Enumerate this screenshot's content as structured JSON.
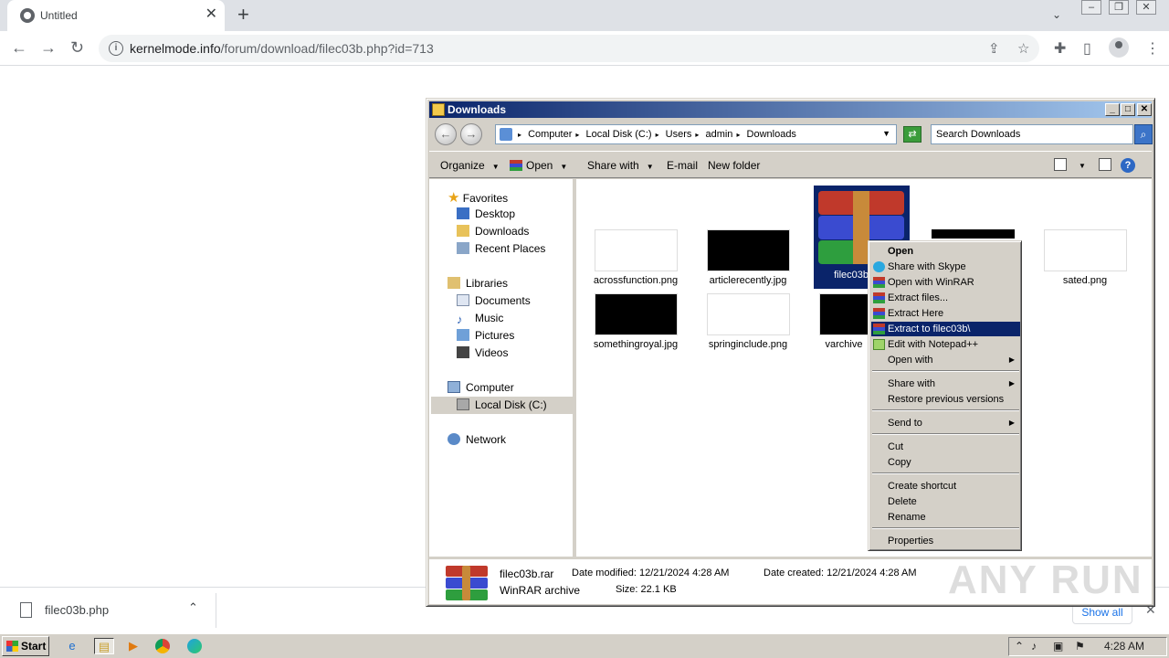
{
  "browser": {
    "tab_title": "Untitled",
    "url_host": "kernelmode.info",
    "url_path": "/forum/download/filec03b.php?id=713"
  },
  "download_bar": {
    "filename": "filec03b.php",
    "show_all": "Show all"
  },
  "explorer": {
    "title": "Downloads",
    "breadcrumbs": [
      "Computer",
      "Local Disk (C:)",
      "Users",
      "admin",
      "Downloads"
    ],
    "search_placeholder": "Search Downloads",
    "commands": {
      "organize": "Organize",
      "open": "Open",
      "share_with": "Share with",
      "email": "E-mail",
      "new_folder": "New folder"
    },
    "nav": {
      "favorites": "Favorites",
      "desktop": "Desktop",
      "downloads": "Downloads",
      "recent_places": "Recent Places",
      "libraries": "Libraries",
      "documents": "Documents",
      "music": "Music",
      "pictures": "Pictures",
      "videos": "Videos",
      "computer": "Computer",
      "local_disk": "Local Disk (C:)",
      "network": "Network"
    },
    "files": [
      "acrossfunction.png",
      "articlerecently.jpg",
      "filec03b",
      "sated.png",
      "somethingroyal.jpg",
      "springinclude.png",
      "varchive"
    ],
    "details": {
      "name": "filec03b.rar",
      "type": "WinRAR archive",
      "modified": "Date modified: 12/21/2024 4:28 AM",
      "created": "Date created: 12/21/2024 4:28 AM",
      "size": "Size: 22.1 KB"
    }
  },
  "context_menu": {
    "open": "Open",
    "share_skype": "Share with Skype",
    "open_winrar": "Open with WinRAR",
    "extract_files": "Extract files...",
    "extract_here": "Extract Here",
    "extract_to": "Extract to filec03b\\",
    "edit_npp": "Edit with Notepad++",
    "open_with": "Open with",
    "share_with": "Share with",
    "restore": "Restore previous versions",
    "send_to": "Send to",
    "cut": "Cut",
    "copy": "Copy",
    "create_shortcut": "Create shortcut",
    "delete": "Delete",
    "rename": "Rename",
    "properties": "Properties"
  },
  "taskbar": {
    "start": "Start",
    "clock": "4:28 AM"
  },
  "watermark": "ANY RUN",
  "colors": {
    "selection": "#0a246a",
    "classic_face": "#d4d0c8",
    "chrome_tabstrip": "#dee1e6"
  }
}
